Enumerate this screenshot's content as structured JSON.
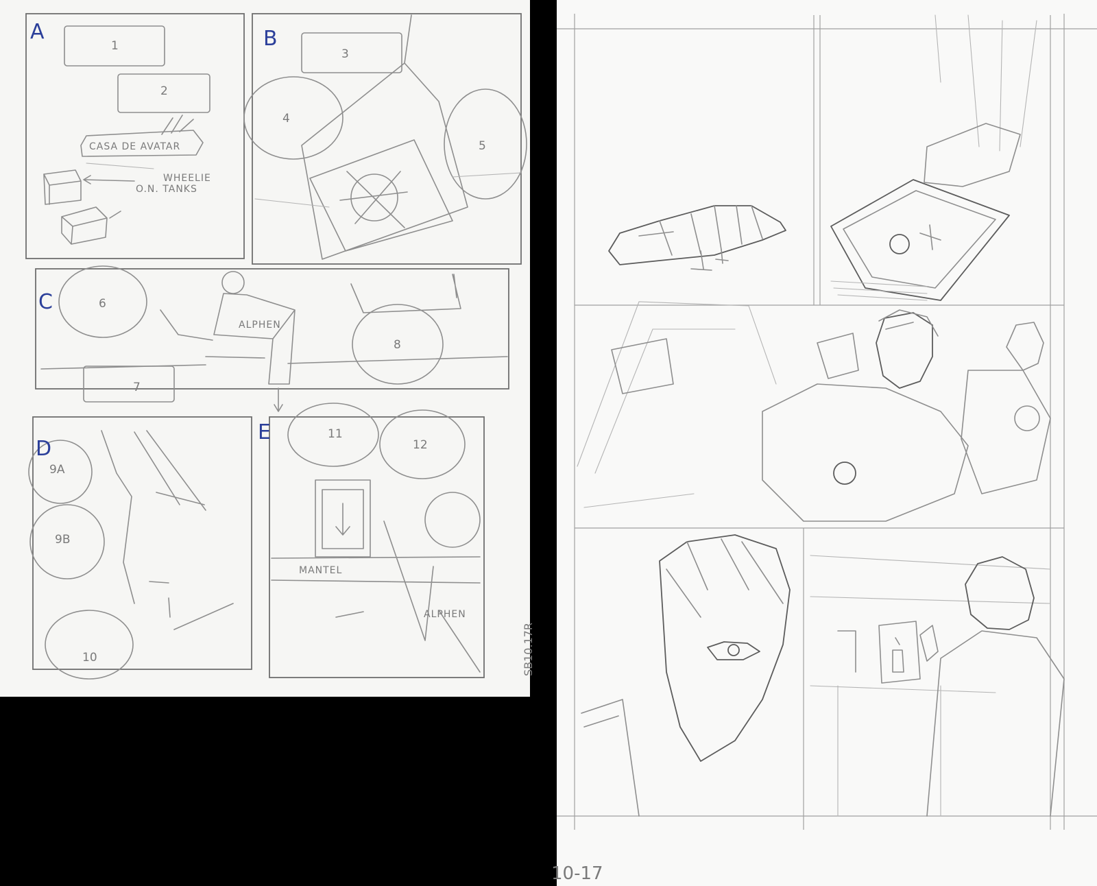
{
  "thumbnail": {
    "ink_color": "#2b3f9a",
    "panel_letters": [
      "A",
      "B",
      "C",
      "D",
      "E"
    ],
    "balloon_numbers": [
      "1",
      "2",
      "3",
      "4",
      "5",
      "6",
      "7",
      "8",
      "9A",
      "9B",
      "10",
      "11",
      "12"
    ],
    "notes": {
      "casa": "CASA DE AVATAR",
      "wheelie": "WHEELIE",
      "tanks": "O.N. TANKS",
      "alphen_c": "ALPHEN",
      "mantel": "MANTEL",
      "alphen_e": "ALPHEN"
    },
    "signature": "SB10.17R"
  },
  "pencils": {
    "page_date": "10-17"
  }
}
